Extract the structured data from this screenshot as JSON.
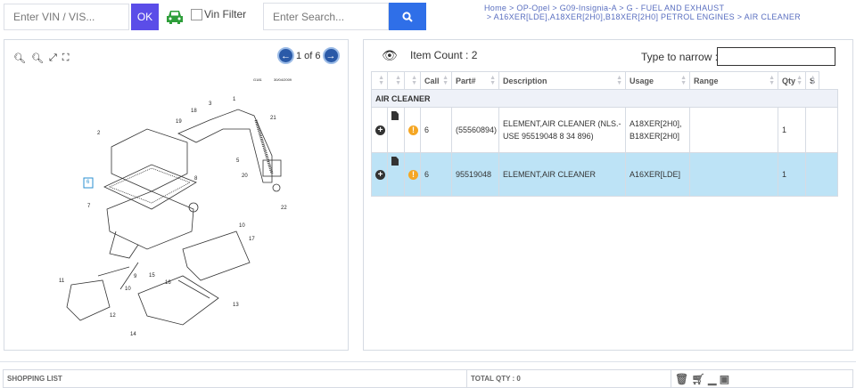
{
  "topbar": {
    "vin_placeholder": "Enter VIN / VIS...",
    "ok_label": "OK",
    "vin_filter_label": "Vin Filter",
    "search_placeholder": "Enter Search..."
  },
  "breadcrumb": [
    "Home",
    "OP-Opel",
    "G09-Insignia-A",
    "G - FUEL AND EXHAUST",
    "A16XER[LDE],A18XER[2H0],B18XER[2H0] PETROL ENGINES",
    "AIR CLEANER"
  ],
  "diagram": {
    "page": "1 of 6",
    "ref": "G181",
    "date": "30/04/2009",
    "callouts": [
      "2",
      "19",
      "18",
      "3",
      "1",
      "21",
      "5",
      "20",
      "6",
      "8",
      "7",
      "22",
      "10",
      "17",
      "9",
      "11",
      "10",
      "15",
      "16",
      "13",
      "12",
      "14"
    ]
  },
  "parts": {
    "item_count": "Item Count : 2",
    "narrow_label": "Type to narrow :",
    "narrow_value": "",
    "columns": [
      "",
      "",
      "",
      "Call",
      "Part#",
      "Description",
      "Usage",
      "Range",
      "Qty",
      "S"
    ],
    "group": "AIR CLEANER",
    "rows": [
      {
        "call": "6",
        "part": "(55560894)",
        "description": "ELEMENT,AIR CLEANER (NLS.-USE 95519048 8 34 896)",
        "usage": "A18XER[2H0],B18XER[2H0]",
        "range": "",
        "qty": "1"
      },
      {
        "call": "6",
        "part": "95519048",
        "description": "ELEMENT,AIR CLEANER",
        "usage": "A16XER[LDE]",
        "range": "",
        "qty": "1",
        "selected": true
      }
    ]
  },
  "shopping": {
    "title": "SHOPPING LIST",
    "total": "TOTAL QTY : 0"
  },
  "colors": {
    "ok": "#5b4de8",
    "search": "#2f6fe8",
    "car": "#2e9e3a",
    "selected_row": "#bde3f6",
    "breadcrumb": "#5a6fc0"
  }
}
